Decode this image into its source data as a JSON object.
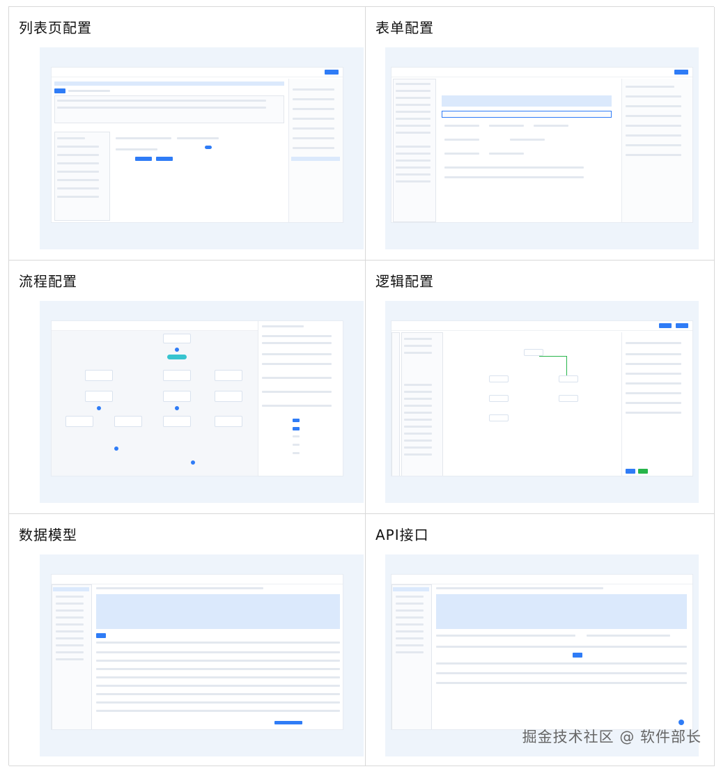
{
  "panels": [
    {
      "title": "列表页配置"
    },
    {
      "title": "表单配置"
    },
    {
      "title": "流程配置"
    },
    {
      "title": "逻辑配置"
    },
    {
      "title": "数据模型"
    },
    {
      "title": "API接口"
    }
  ],
  "watermark": "掘金技术社区 @ 软件部长",
  "colors": {
    "accent": "#2f7cf6",
    "shot_bg": "#eef4fb",
    "border": "#d8d8d8"
  }
}
